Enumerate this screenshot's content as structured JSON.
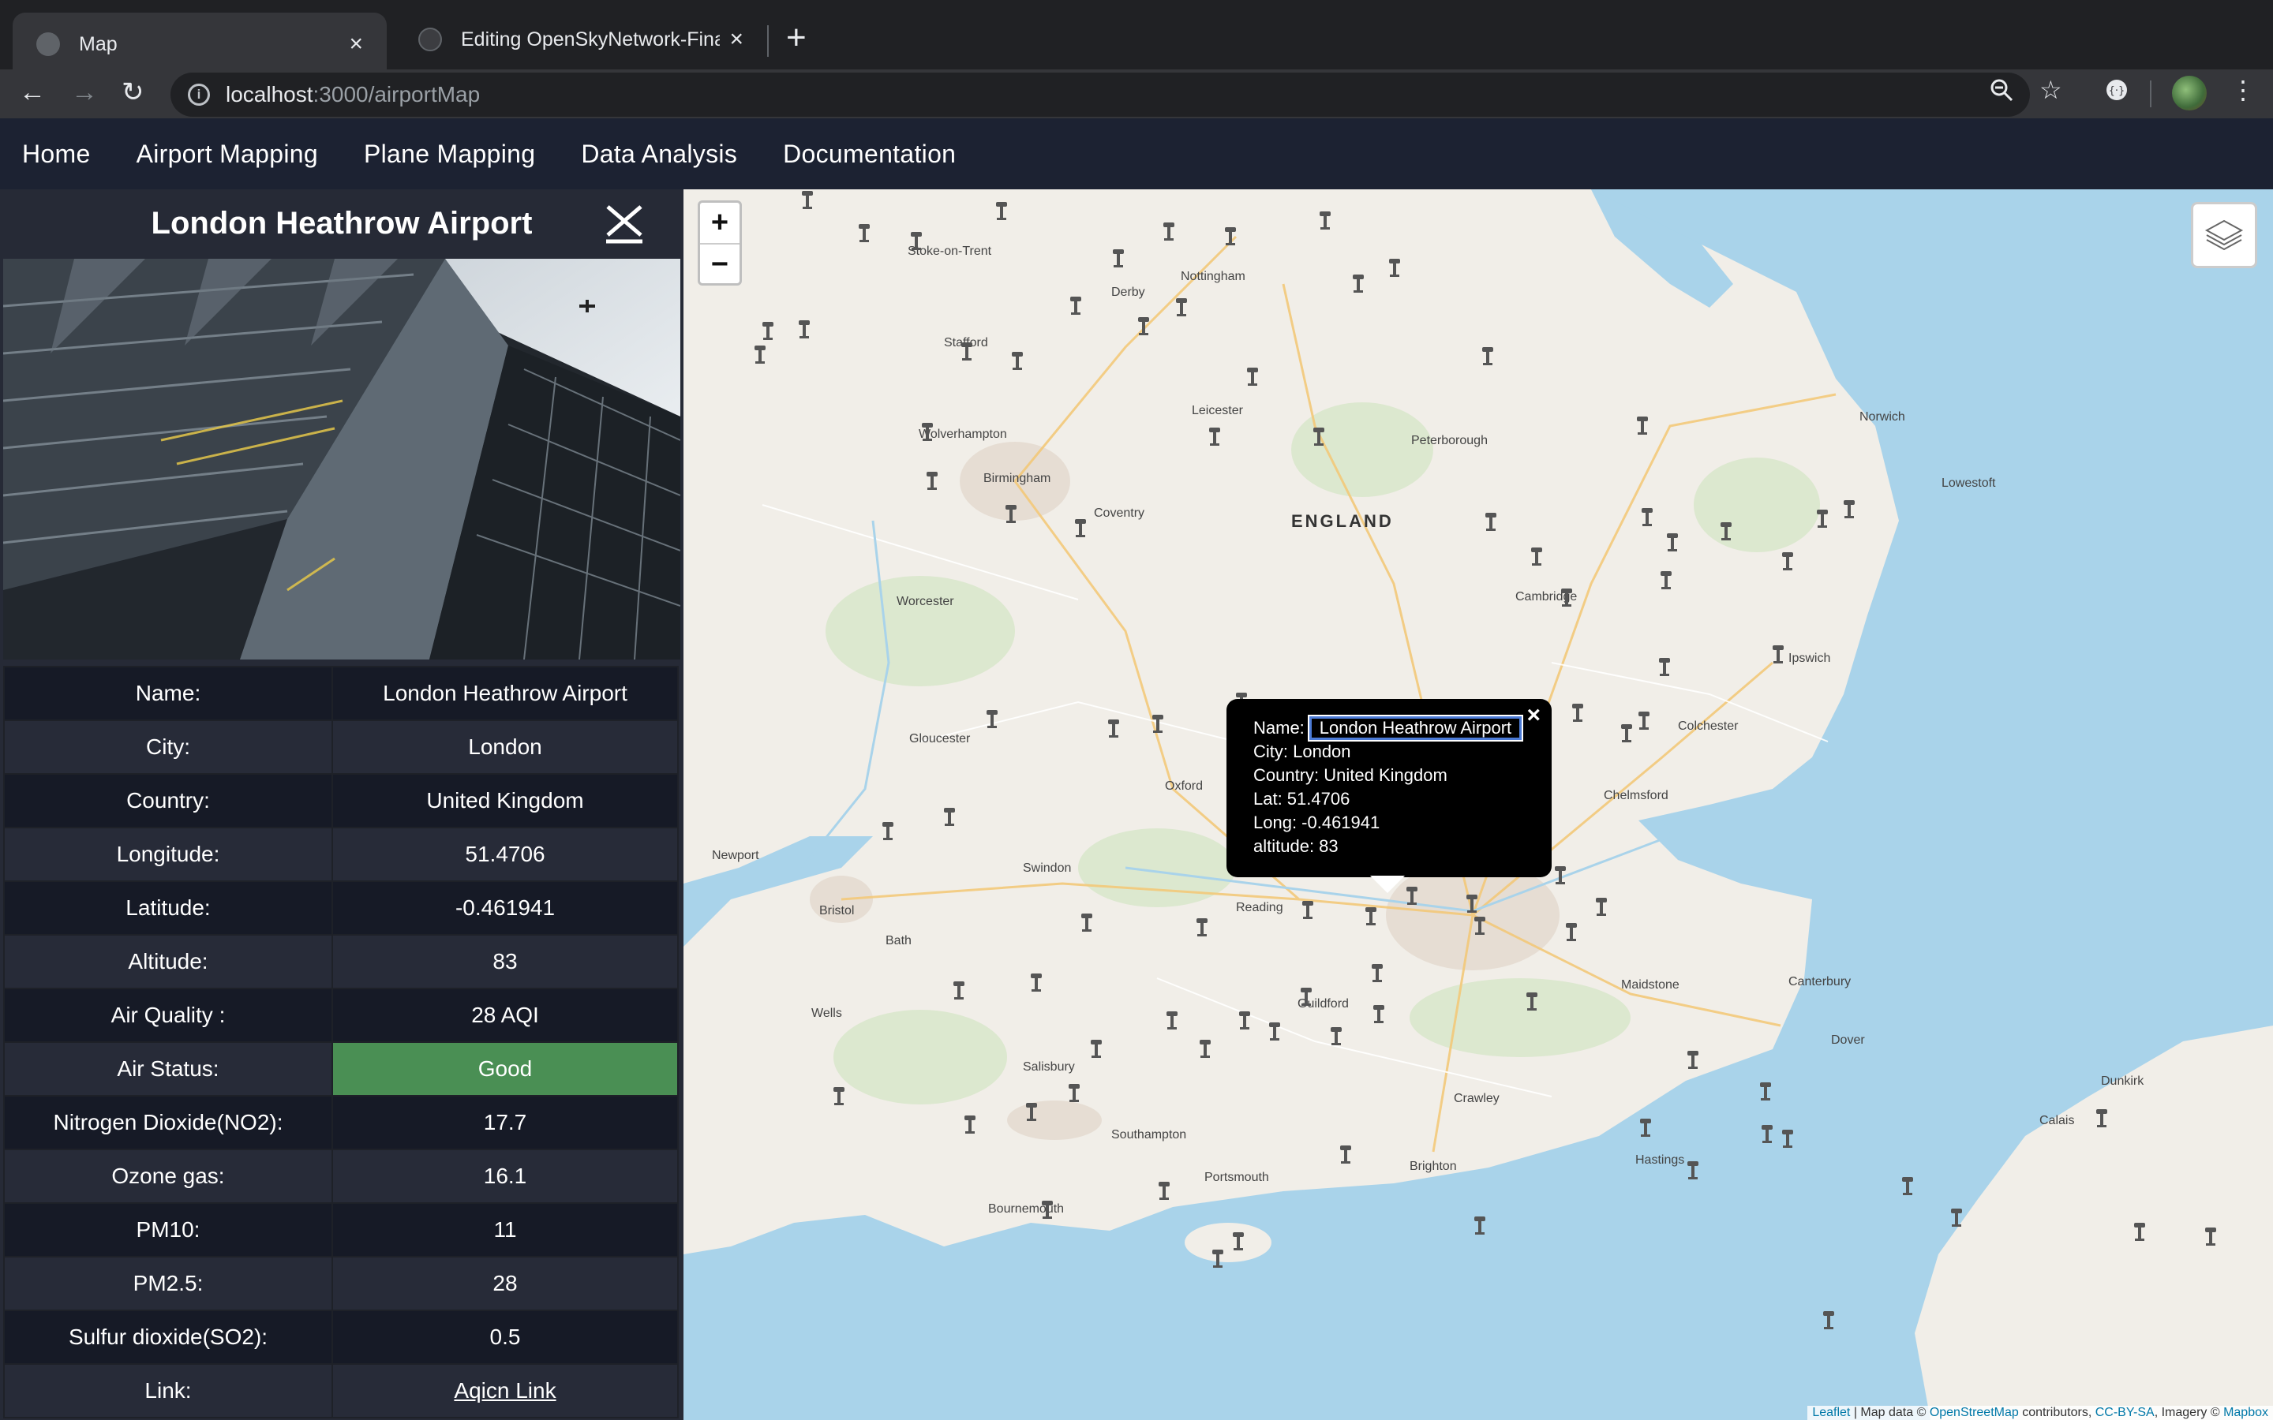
{
  "browser": {
    "tabs": [
      {
        "title": "Map",
        "active": true
      },
      {
        "title": "Editing OpenSkyNetwork-Final",
        "active": false
      }
    ],
    "url_host": "localhost",
    "url_path": ":3000/airportMap"
  },
  "nav": {
    "items": [
      "Home",
      "Airport Mapping",
      "Plane Mapping",
      "Data Analysis",
      "Documentation"
    ]
  },
  "sidebar": {
    "title": "London Heathrow Airport",
    "rows": [
      {
        "label": "Name:",
        "value": "London Heathrow Airport"
      },
      {
        "label": "City:",
        "value": "London"
      },
      {
        "label": "Country:",
        "value": "United Kingdom"
      },
      {
        "label": "Longitude:",
        "value": "51.4706"
      },
      {
        "label": "Latitude:",
        "value": "-0.461941"
      },
      {
        "label": "Altitude:",
        "value": "83"
      },
      {
        "label": "Air Quality :",
        "value": "28 AQI"
      },
      {
        "label": "Air Status:",
        "value": "Good"
      },
      {
        "label": "Nitrogen Dioxide(NO2):",
        "value": "17.7"
      },
      {
        "label": "Ozone gas:",
        "value": "16.1"
      },
      {
        "label": "PM10:",
        "value": "11"
      },
      {
        "label": "PM2.5:",
        "value": "28"
      },
      {
        "label": "Sulfur dioxide(SO2):",
        "value": "0.5"
      },
      {
        "label": "Link:",
        "value": "Aqicn Link"
      }
    ],
    "status_color": "#4a8f54"
  },
  "map": {
    "zoom_in": "+",
    "zoom_out": "−",
    "popup": {
      "name_label": "Name:",
      "name_value": "London Heathrow Airport",
      "city": "City: London",
      "country": "Country: United Kingdom",
      "lat": "Lat: 51.4706",
      "long": "Long: -0.461941",
      "altitude": "altitude: 83",
      "close": "×"
    },
    "labels": [
      "ENGLAND",
      "Birmingham",
      "Leicester",
      "Nottingham",
      "Derby",
      "Coventry",
      "Peterborough",
      "Cambridge",
      "Norwich",
      "Ipswich",
      "Colchester",
      "Oxford",
      "Reading",
      "Bristol",
      "Bath",
      "Swindon",
      "Southampton",
      "Portsmouth",
      "Brighton",
      "Canterbury",
      "Dover",
      "Dunkirk",
      "Calais",
      "Gloucester",
      "Worcester",
      "Guildford",
      "Maidstone",
      "Chelmsford",
      "Bournemouth",
      "Salisbury",
      "Newport",
      "Wells",
      "Stoke-on-Trent",
      "Wolverhampton",
      "Lowestoft",
      "Stafford",
      "Hastings",
      "Crawley"
    ],
    "attribution_leaflet": "Leaflet",
    "attribution_text": "| Map data ©",
    "attribution_osm": "OpenStreetMap",
    "attribution_rest": "contributors,",
    "attribution_cc": "CC-BY-SA",
    "attribution_imagery": ", Imagery ©",
    "attribution_mapbox": "Mapbox"
  },
  "colors": {
    "water": "#a9d3ea",
    "land": "#f1eee8",
    "navbar": "#1c2232"
  }
}
